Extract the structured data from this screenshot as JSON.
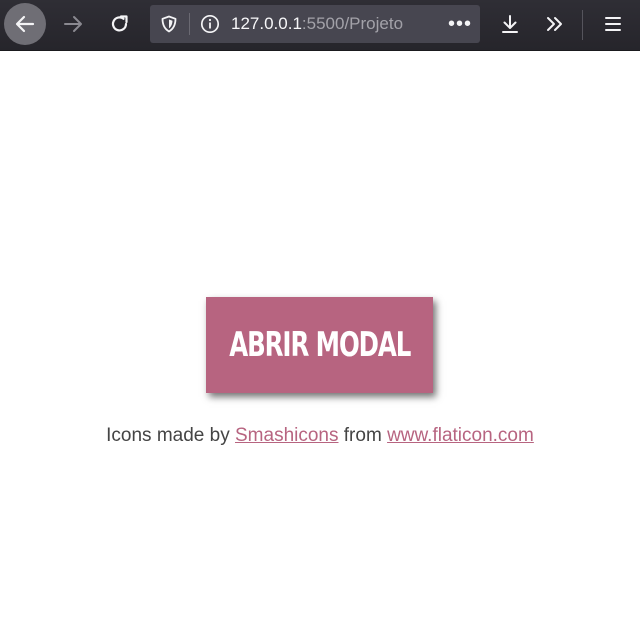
{
  "browser": {
    "url_host": "127.0.0.1",
    "url_rest": ":5500/Projeto",
    "more_label": "•••",
    "icons": [
      "back-arrow-icon",
      "forward-arrow-icon",
      "reload-icon",
      "shield-icon",
      "info-icon",
      "download-icon",
      "chevrons-right-icon",
      "hamburger-menu-icon"
    ]
  },
  "page": {
    "button_label": "ABRIR MODAL",
    "credits": {
      "prefix": "Icons made by",
      "author": "Smashicons",
      "middle": "from",
      "site": "www.flaticon.com"
    },
    "colors": {
      "button_bg": "#b76480",
      "link": "#b76480",
      "text": "#444444",
      "toolbar": "#2b2a33"
    }
  }
}
